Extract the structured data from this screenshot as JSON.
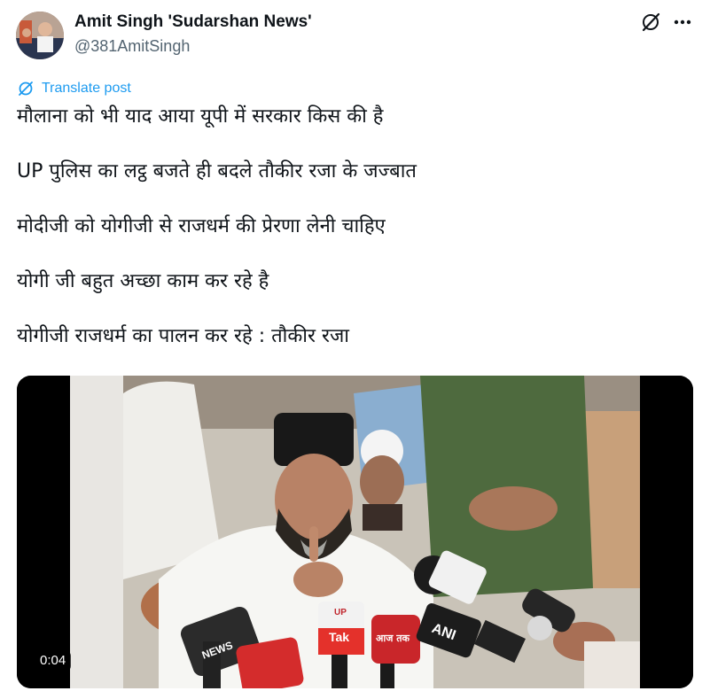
{
  "author": {
    "display_name": "Amit Singh 'Sudarshan News'",
    "handle": "@381AmitSingh"
  },
  "header_icons": [
    "grok-icon",
    "more-options-icon"
  ],
  "translate_label": "Translate post",
  "tweet_lines": [
    "मौलाना को भी याद आया यूपी में सरकार किस की है",
    "UP पुलिस का लट्ठ बजते ही बदले तौकीर रजा के जज्बात",
    "मोदीजी को योगीजी से राजधर्म की प्रेरणा लेनी चाहिए",
    "योगी जी बहुत अच्छा काम कर रहे है",
    "योगीजी राजधर्म का पालन कर रहे : तौकीर रजा"
  ],
  "video": {
    "timestamp": "0:04",
    "mic_labels": {
      "up_tak_top": "UP",
      "up_tak_bottom": "Tak",
      "ani": "ANI",
      "news_1": "NEWS",
      "aaj_tak": "आज तक"
    }
  },
  "colors": {
    "link": "#1d9bf0",
    "secondary_text": "#536471",
    "primary_text": "#0f1419"
  }
}
